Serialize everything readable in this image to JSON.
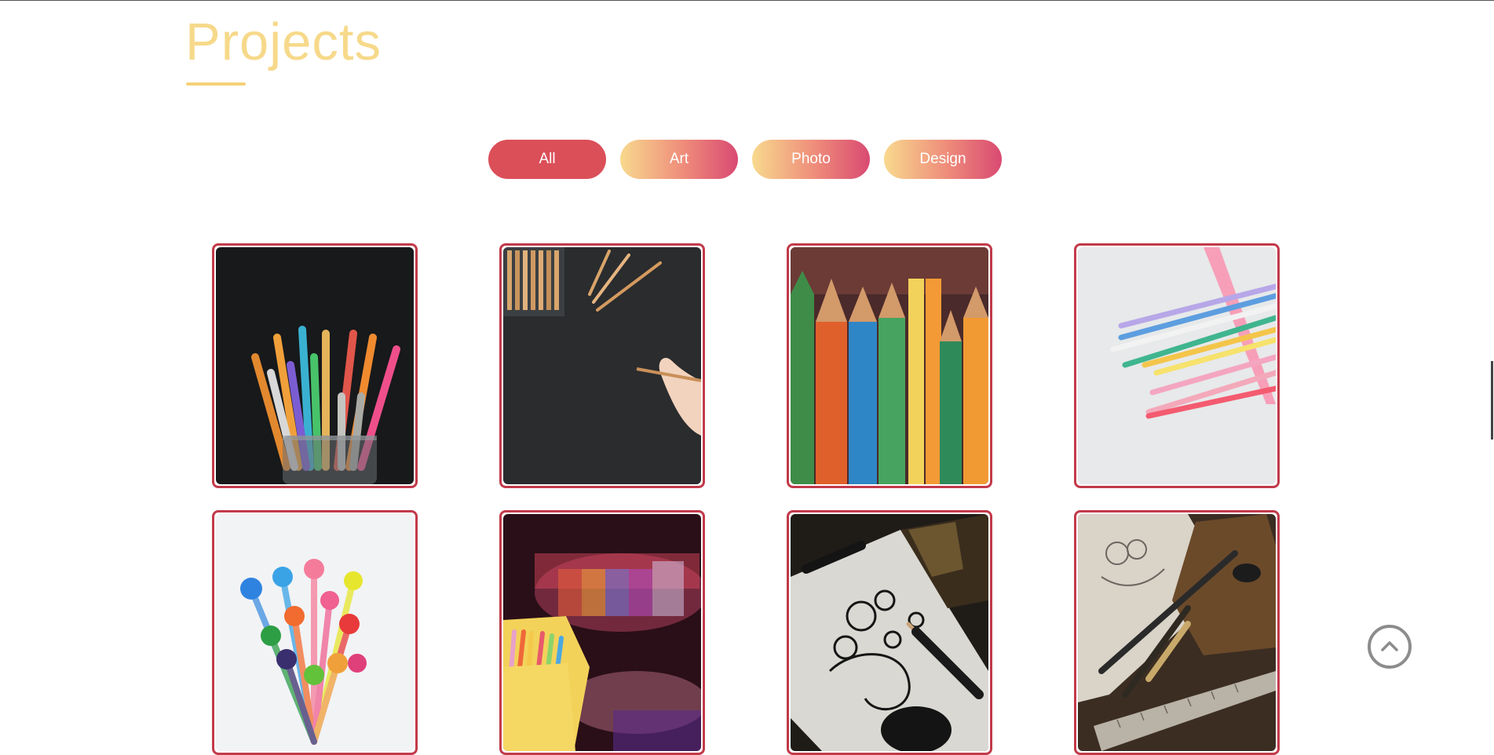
{
  "section": {
    "title": "Projects"
  },
  "filters": [
    {
      "label": "All",
      "active": true
    },
    {
      "label": "Art",
      "active": false
    },
    {
      "label": "Photo",
      "active": false
    },
    {
      "label": "Design",
      "active": false
    }
  ],
  "projects": [
    {
      "subject": "markers-in-glass-jar"
    },
    {
      "subject": "hand-drawing-on-black"
    },
    {
      "subject": "colored-pencils-closeup"
    },
    {
      "subject": "pastel-pencils-on-white"
    },
    {
      "subject": "colorful-marker-caps"
    },
    {
      "subject": "crayons-in-yellow-holder"
    },
    {
      "subject": "ink-sketch-with-pens"
    },
    {
      "subject": "sketchbook-with-tools"
    }
  ],
  "icons": {
    "scroll_top": "chevron-up-icon"
  },
  "colors": {
    "title": "#f6d98a",
    "active_filter": "#db4f58",
    "card_border": "#c23a4a"
  }
}
